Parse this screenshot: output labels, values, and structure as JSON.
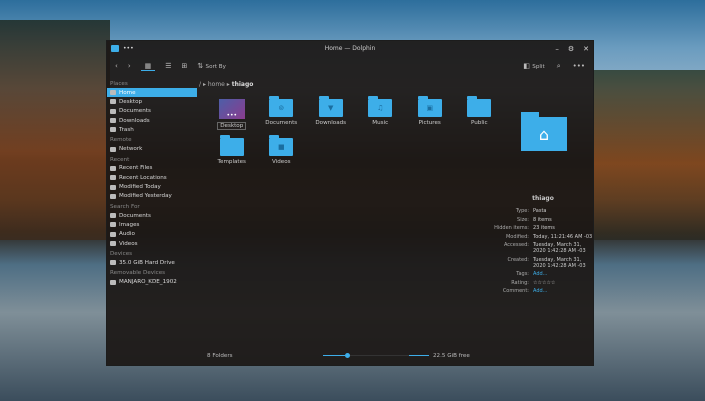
{
  "window": {
    "title": "Home — Dolphin",
    "minimize": "–",
    "maximize": "⚙",
    "close": "✕",
    "menu": "•••"
  },
  "toolbar": {
    "back": "‹",
    "forward": "›",
    "sort_by": "Sort By",
    "split": "Split",
    "search": "⌕",
    "more": "•••"
  },
  "breadcrumb": {
    "root": "/",
    "parts": [
      "home",
      "thiago"
    ]
  },
  "sidebar": {
    "sections": [
      {
        "title": "Places",
        "items": [
          "Home",
          "Desktop",
          "Documents",
          "Downloads",
          "Trash"
        ]
      },
      {
        "title": "Remote",
        "items": [
          "Network"
        ]
      },
      {
        "title": "Recent",
        "items": [
          "Recent Files",
          "Recent Locations",
          "Modified Today",
          "Modified Yesterday"
        ]
      },
      {
        "title": "Search For",
        "items": [
          "Documents",
          "Images",
          "Audio",
          "Videos"
        ]
      },
      {
        "title": "Devices",
        "items": [
          "35.0 GiB Hard Drive"
        ]
      },
      {
        "title": "Removable Devices",
        "items": [
          "MANJARO_KDE_1902"
        ]
      }
    ],
    "active": "Home"
  },
  "files": [
    {
      "name": "Desktop",
      "glyph": "•••"
    },
    {
      "name": "Documents",
      "glyph": "⊚"
    },
    {
      "name": "Downloads",
      "glyph": "▼"
    },
    {
      "name": "Music",
      "glyph": "♫"
    },
    {
      "name": "Pictures",
      "glyph": "▣"
    },
    {
      "name": "Public",
      "glyph": ""
    },
    {
      "name": "Templates",
      "glyph": ""
    },
    {
      "name": "Videos",
      "glyph": "■"
    }
  ],
  "info": {
    "name": "thiago",
    "glyph": "⌂",
    "rows": [
      {
        "k": "Type:",
        "v": "Pasta"
      },
      {
        "k": "Size:",
        "v": "8 items"
      },
      {
        "k": "Hidden items:",
        "v": "23 items"
      },
      {
        "k": "Modified:",
        "v": "Today, 11:21:46 AM -03"
      },
      {
        "k": "Accessed:",
        "v": "Tuesday, March 31, 2020 1:42:28 AM -03"
      },
      {
        "k": "Created:",
        "v": "Tuesday, March 31, 2020 1:42:28 AM -03"
      },
      {
        "k": "Tags:",
        "v": "Add..."
      },
      {
        "k": "Rating:",
        "v": "☆☆☆☆☆"
      },
      {
        "k": "Comment:",
        "v": "Add..."
      }
    ]
  },
  "status": {
    "count": "8 Folders",
    "free": "22.5 GiB free",
    "zoom_fraction": 0.22
  },
  "accent": "#3daee9"
}
